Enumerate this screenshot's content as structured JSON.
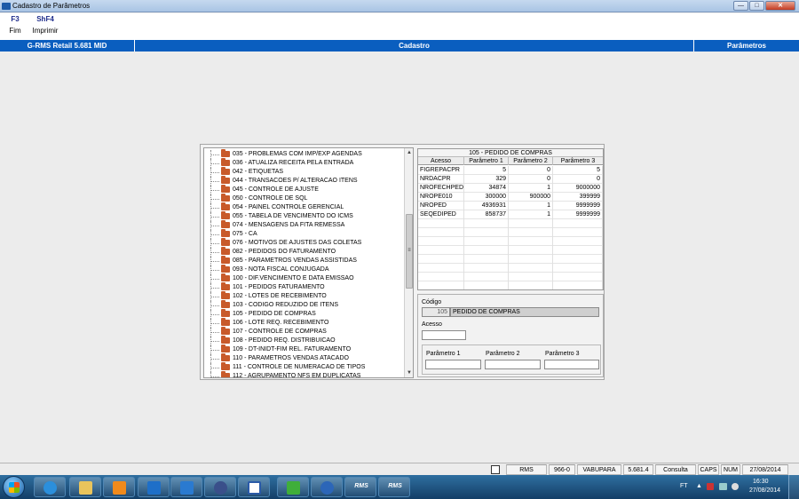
{
  "window": {
    "title": "Cadastro de Parâmetros",
    "controls": {
      "minimize": "—",
      "maximize": "□",
      "close": "✕"
    }
  },
  "keys": [
    {
      "key": "F3",
      "label": "Fim"
    },
    {
      "key": "ShF4",
      "label": "Imprimir"
    }
  ],
  "header": {
    "product": "G-RMS Retail 5.681 MID",
    "section": "Cadastro",
    "area": "Parâmetros"
  },
  "tree": {
    "items": [
      "035 - PROBLEMAS COM IMP/EXP AGENDAS",
      "036 - ATUALIZA RECEITA PELA ENTRADA",
      "042 - ETIQUETAS",
      "044 - TRANSACOES P/ ALTERACAO ITENS",
      "045 - CONTROLE DE AJUSTE",
      "050 - CONTROLE DE SQL",
      "054 - PAINEL CONTROLE GERENCIAL",
      "055 - TABELA DE VENCIMENTO DO ICMS",
      "074 - MENSAGENS DA FITA REMESSA",
      "075 - CA",
      "076 - MOTIVOS DE AJUSTES DAS COLETAS",
      "082 - PEDIDOS DO FATURAMENTO",
      "085 - PARAMETROS VENDAS ASSISTIDAS",
      "093 - NOTA FISCAL CONJUGADA",
      "100 - DIF.VENCIMENTO E DATA EMISSAO",
      "101 - PEDIDOS FATURAMENTO",
      "102 - LOTES DE RECEBIMENTO",
      "103 - CODIGO REDUZIDO DE ITENS",
      "105 - PEDIDO DE COMPRAS",
      "106 - LOTE REQ. RECEBIMENTO",
      "107 - CONTROLE DE COMPRAS",
      "108 - PEDIDO REQ. DISTRIBUICAO",
      "109 - DT-INIDT-FIM REL. FATURAMENTO",
      "110 - PARAMETROS VENDAS ATACADO",
      "111 - CONTROLE DE NUMERACAO DE TIPOS",
      "112 - AGRUPAMENTO NFS EM DUPLICATAS"
    ],
    "scroll": {
      "up": "▲",
      "down": "▼",
      "grip": "≡"
    }
  },
  "grid": {
    "title": "105 - PEDIDO DE COMPRAS",
    "columns": [
      "Acesso",
      "Parâmetro 1",
      "Parâmetro 2",
      "Parâmetro 3"
    ],
    "rows": [
      [
        "FIGREPACPR",
        "5",
        "0",
        "5"
      ],
      [
        "NRDACPR",
        "329",
        "0",
        "0"
      ],
      [
        "NROFECHPED",
        "34874",
        "1",
        "9000000"
      ],
      [
        "NROPE010",
        "300000",
        "900000",
        "399999"
      ],
      [
        "NROPED",
        "4936931",
        "1",
        "9999999"
      ],
      [
        "SEQEDIPED",
        "858737",
        "1",
        "9999999"
      ]
    ]
  },
  "form": {
    "codigo_label": "Código",
    "codigo_value": "105",
    "codigo_desc": "PEDIDO DE COMPRAS",
    "acesso_label": "Acesso",
    "acesso_value": "",
    "param1_label": "Parâmetro 1",
    "param2_label": "Parâmetro 2",
    "param3_label": "Parâmetro 3",
    "param1_value": "",
    "param2_value": "",
    "param3_value": ""
  },
  "status": {
    "system": "RMS",
    "code": "966-0",
    "user": "VABUPARA",
    "version": "5.681.4",
    "mode": "Consulta",
    "caps": "CAPS",
    "num": "NUM",
    "date": "27/08/2014"
  },
  "taskbar": {
    "apps": [
      "rms-app",
      "rms-app"
    ],
    "app_label": "RMS",
    "tray_lang": "FT",
    "tray_arrow": "▲",
    "clock_time": "16:30",
    "clock_date": "27/08/2014"
  }
}
